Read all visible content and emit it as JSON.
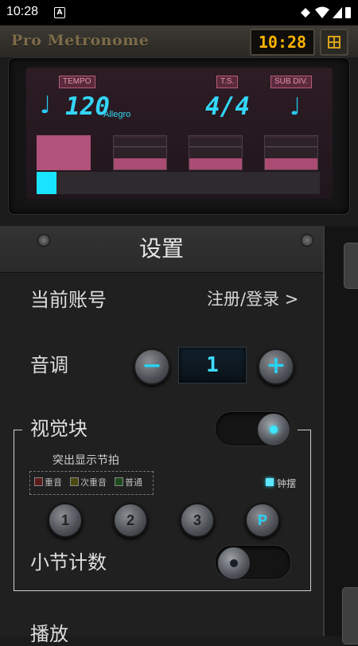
{
  "status_bar": {
    "time": "10:28",
    "notification_icon": "A"
  },
  "app": {
    "brand": "Pro Metronome",
    "clock": "10:28"
  },
  "lcd": {
    "tempo_label": "TEMPO",
    "ts_label": "T.S.",
    "subdiv_label": "SUB DIV.",
    "tempo_value": "120",
    "tempo_marking": "Allegro",
    "time_signature": "4/4",
    "note_glyph": "♩",
    "beats": [
      {
        "state": "active"
      },
      {
        "state": "idle"
      },
      {
        "state": "idle"
      },
      {
        "state": "idle"
      }
    ],
    "progress_fraction": 0.07
  },
  "settings": {
    "title": "设置",
    "account_label": "当前账号",
    "account_link": "注册/登录 >",
    "key_label": "音调",
    "key_minus": "−",
    "key_plus": "+",
    "key_value": "1",
    "visual_block_label": "视觉块",
    "highlight_label": "突出显示节拍",
    "legend": [
      {
        "label": "重音",
        "color": "#5b1a1a"
      },
      {
        "label": "次重音",
        "color": "#4a4a10"
      },
      {
        "label": "普通",
        "color": "#1f4a1f"
      }
    ],
    "pendulum_label": "钟摆",
    "beat_buttons": [
      "1",
      "2",
      "3",
      "P"
    ],
    "bar_count_label": "小节计数",
    "play_label": "播放"
  },
  "colors": {
    "accent": "#25d3f3",
    "beat_active": "#b0527a",
    "clock": "#ffb300"
  }
}
